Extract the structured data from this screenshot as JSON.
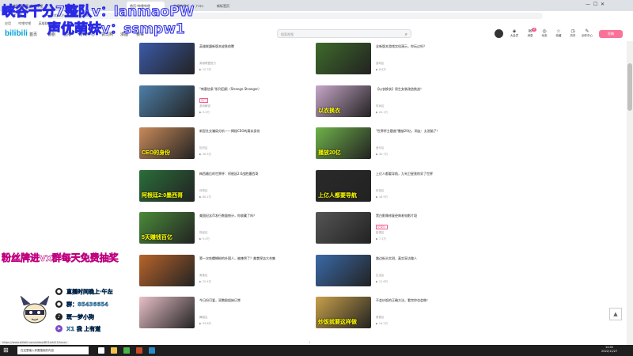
{
  "browser": {
    "tabs": [
      {
        "label": "英雄联盟赛事_哔哩哔哩",
        "active": false
      },
      {
        "label": "首页-哔哩哔哩",
        "active": true
      },
      {
        "label": "哔哩哔哩 (゜-゜)つロ",
        "active": false
      },
      {
        "label": "新标签页",
        "active": false
      }
    ],
    "url": "https://www.bilibili.com/",
    "bookmarks": [
      "应用",
      "哔哩哔哩",
      "英雄联盟赛事"
    ]
  },
  "header": {
    "logo": "bilibili",
    "nav": [
      "首页",
      "番剧",
      "直播",
      "游戏中心",
      "会员购",
      "漫画",
      "赛事"
    ],
    "search_placeholder": "搜索视频",
    "icons": [
      {
        "label": "大会员",
        "icon": "vip-icon"
      },
      {
        "label": "消息",
        "icon": "message-icon",
        "badge": "2"
      },
      {
        "label": "动态",
        "icon": "dynamic-icon"
      },
      {
        "label": "收藏",
        "icon": "favorite-icon"
      },
      {
        "label": "历史",
        "icon": "history-icon"
      },
      {
        "label": "创作中心",
        "icon": "creator-icon"
      }
    ],
    "upload_label": "投稿"
  },
  "cards": [
    {
      "title": "英雄联盟新版本皮肤前瞻",
      "meta": "英雄联盟官方",
      "stat": "12.3万",
      "overlay": "",
      "tag": "",
      "bg": "#3b5aa8"
    },
    {
      "title": "全新版本游戏实机演示，你玩过吗？",
      "meta": "游戏区",
      "stat": "8.6万",
      "overlay": "",
      "tag": "",
      "bg": "#3e6b2a"
    },
    {
      "title": "\"刺客信条\"系列回顾（Strange Stranger）",
      "meta": "游戏解说",
      "stat": "5.2万",
      "overlay": "",
      "tag": "热门",
      "bg": "#4d7fa8"
    },
    {
      "title": "【以衣换衣】男生女装改造挑战！",
      "meta": "时尚区",
      "stat": "20.1万",
      "overlay": "以衣换衣",
      "tag": "",
      "bg": "#c7a6c8"
    },
    {
      "title": "新型社交骗局分析——揭秘CEO的真实身份",
      "meta": "知识区",
      "stat": "30.5万",
      "overlay": "CEO的身份",
      "tag": "",
      "bg": "#c88a5a"
    },
    {
      "title": "\"世界杯主题曲\"播放20亿，网友：太洗脑了！",
      "meta": "音乐区",
      "stat": "45.7万",
      "overlay": "播放20亿",
      "tag": "",
      "bg": "#6fb24a"
    },
    {
      "title": "梅西最后的世界杯：阿根廷2:0战胜墨西哥",
      "meta": "体育区",
      "stat": "60.2万",
      "overlay": "阿根廷2:0墨西哥",
      "tag": "",
      "bg": "#2a6e3a"
    },
    {
      "title": "上亿人都要导航，九旬卫星竟惊呆了世界",
      "meta": "科技区",
      "stat": "18.9万",
      "overlay": "上亿人都要导航",
      "tag": "",
      "bg": "#2a2a2a"
    },
    {
      "title": "美国纪念币发行数量统计，你收藏了吗？",
      "meta": "财经区",
      "stat": "9.4万",
      "overlay": "5天赚钱百亿",
      "tag": "",
      "bg": "#4a8a3a"
    },
    {
      "title": "黑白影像修复经典老电影片段",
      "meta": "影视区",
      "stat": "7.1万",
      "overlay": "",
      "tag": "纪录片",
      "bg": "#555555"
    },
    {
      "title": "第一次吃螺蛳粉的外国人，被辣哭了？美食探店大合集",
      "meta": "美食区",
      "stat": "22.4万",
      "overlay": "",
      "tag": "",
      "bg": "#b8642a"
    },
    {
      "title": "路边街头实测，真实采访路人",
      "meta": "生活区",
      "stat": "11.6万",
      "overlay": "",
      "tag": "",
      "bg": "#3a6aa8"
    },
    {
      "title": "今日份可爱，双胞胎姐妹日常",
      "meta": "舞蹈区",
      "stat": "33.8万",
      "overlay": "",
      "tag": "",
      "bg": "#e8c0c8"
    },
    {
      "title": "不会炒饭的正确方法，看完你也会做！",
      "meta": "美食区",
      "stat": "14.2万",
      "overlay": "炒饭就要这样做",
      "tag": "",
      "bg": "#c8a04a"
    }
  ],
  "status_url": "https://www.bilibili.com/video/BV1a4411Xxxxx",
  "footer_num": "1",
  "taskbar": {
    "search": "在这里输入你要搜索的内容",
    "time": "14:02",
    "date": "2022/11/27"
  },
  "overlay": {
    "watermark_line1": "峡谷千分7整队v：lanmaoPW",
    "watermark_line2": "声优萌妹v：ssmpw1",
    "fan_line": "粉丝牌进vx群每天免费抽奖",
    "contacts": [
      {
        "icon": "penguin-icon",
        "text": "直播时间晚上·午左"
      },
      {
        "icon": "qq-icon",
        "text": "群：85436654"
      },
      {
        "icon": "douyin-icon",
        "text": "斑一梦小狗"
      },
      {
        "icon": "rocket-icon",
        "text": "X1 我 上有道"
      }
    ]
  },
  "colors": {
    "accent": "#00a1d6",
    "pink": "#fb7299",
    "watermark_stroke": "#2a2ae6"
  }
}
